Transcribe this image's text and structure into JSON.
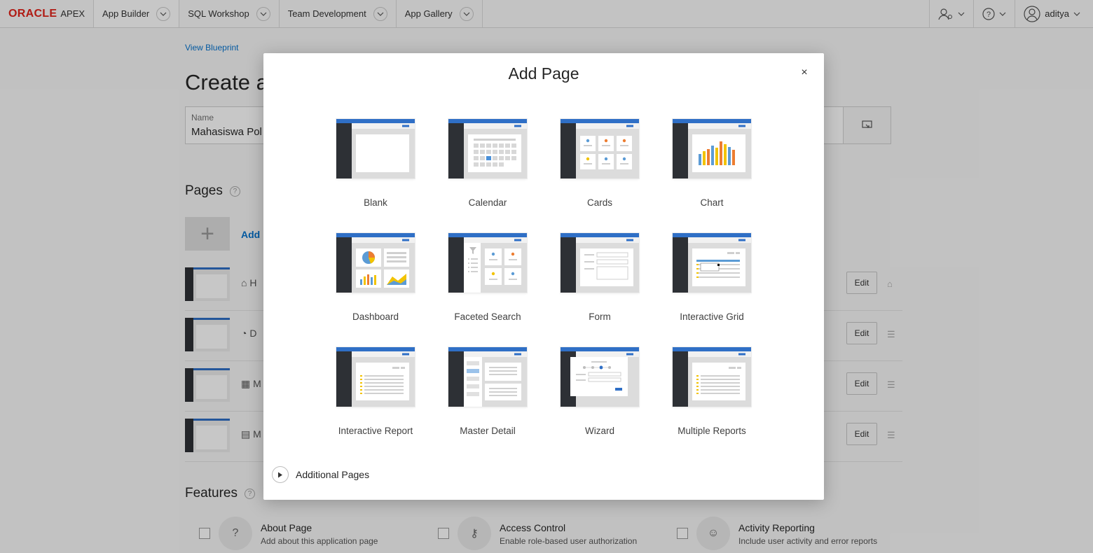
{
  "topbar": {
    "brand_oracle": "ORACLE",
    "brand_apex": "APEX",
    "tabs": [
      {
        "label": "App Builder"
      },
      {
        "label": "SQL Workshop"
      },
      {
        "label": "Team Development"
      },
      {
        "label": "App Gallery"
      }
    ],
    "user": "aditya"
  },
  "background": {
    "view_blueprint": "View Blueprint",
    "title": "Create a",
    "name_label": "Name",
    "name_value": "Mahasiswa Pol",
    "pages_heading": "Pages",
    "add_label": "Add",
    "edit_label": "Edit",
    "rows": [
      {
        "text": "H"
      },
      {
        "text": "D"
      },
      {
        "text": "M"
      },
      {
        "text": "M"
      }
    ],
    "features_heading": "Features",
    "features": [
      {
        "title": "About Page",
        "desc": "Add about this application page"
      },
      {
        "title": "Access Control",
        "desc": "Enable role-based user authorization"
      },
      {
        "title": "Activity Reporting",
        "desc": "Include user activity and error reports"
      }
    ]
  },
  "dialog": {
    "title": "Add Page",
    "close_label": "×",
    "tiles": [
      {
        "label": "Blank",
        "icon": "blank"
      },
      {
        "label": "Calendar",
        "icon": "calendar"
      },
      {
        "label": "Cards",
        "icon": "cards"
      },
      {
        "label": "Chart",
        "icon": "chart"
      },
      {
        "label": "Dashboard",
        "icon": "dashboard"
      },
      {
        "label": "Faceted Search",
        "icon": "faceted"
      },
      {
        "label": "Form",
        "icon": "form"
      },
      {
        "label": "Interactive Grid",
        "icon": "grid"
      },
      {
        "label": "Interactive Report",
        "icon": "ireport"
      },
      {
        "label": "Master Detail",
        "icon": "masterdetail"
      },
      {
        "label": "Wizard",
        "icon": "wizard"
      },
      {
        "label": "Multiple Reports",
        "icon": "multireports"
      }
    ],
    "additional_pages": "Additional Pages"
  },
  "colors": {
    "accent": "#0572ce",
    "header_blue": "#2f6fc6",
    "sidebar_dark": "#2d3035",
    "oracle_red": "#e2231a"
  }
}
